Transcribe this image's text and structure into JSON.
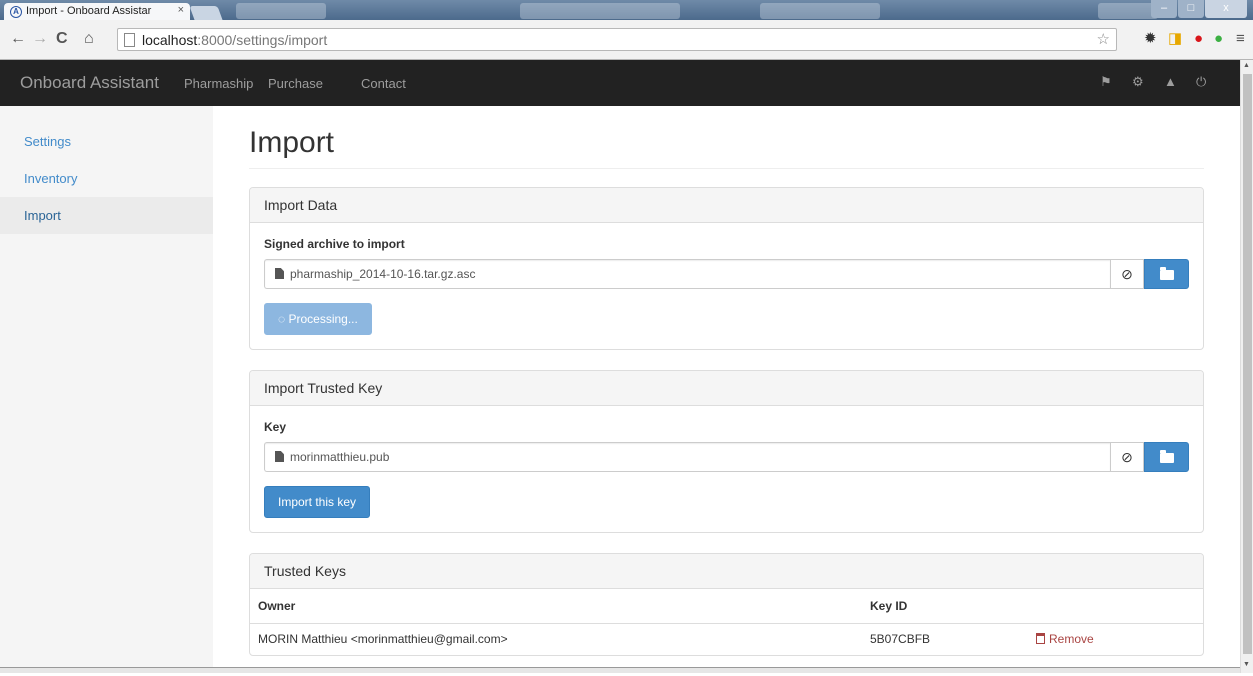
{
  "browser": {
    "tab_title": "Import - Onboard Assistar",
    "tab_favicon_text": "A",
    "tab_close": "×",
    "url_host": "localhost",
    "url_path": ":8000/settings/import",
    "window_minimize": "–",
    "window_maximize": "□",
    "window_close": "x"
  },
  "navbar": {
    "brand": "Onboard Assistant",
    "links": [
      "Pharmaship",
      "Purchase",
      "Contact"
    ]
  },
  "sidebar": {
    "items": [
      {
        "label": "Settings",
        "active": false
      },
      {
        "label": "Inventory",
        "active": false
      },
      {
        "label": "Import",
        "active": true
      }
    ]
  },
  "page": {
    "title": "Import"
  },
  "import_data": {
    "heading": "Import Data",
    "label": "Signed archive to import",
    "filename": "pharmaship_2014-10-16.tar.gz.asc",
    "clear_glyph": "⊘",
    "button": "Processing..."
  },
  "import_key": {
    "heading": "Import Trusted Key",
    "label": "Key",
    "filename": "morinmatthieu.pub",
    "clear_glyph": "⊘",
    "button": "Import this key"
  },
  "trusted_keys": {
    "heading": "Trusted Keys",
    "columns": [
      "Owner",
      "Key ID"
    ],
    "rows": [
      {
        "owner": "MORIN Matthieu <morinmatthieu@gmail.com>",
        "key_id": "5B07CBFB",
        "action": "Remove"
      }
    ]
  },
  "colors": {
    "navbar": "#222222",
    "primary": "#428bca",
    "danger": "#a94442"
  }
}
